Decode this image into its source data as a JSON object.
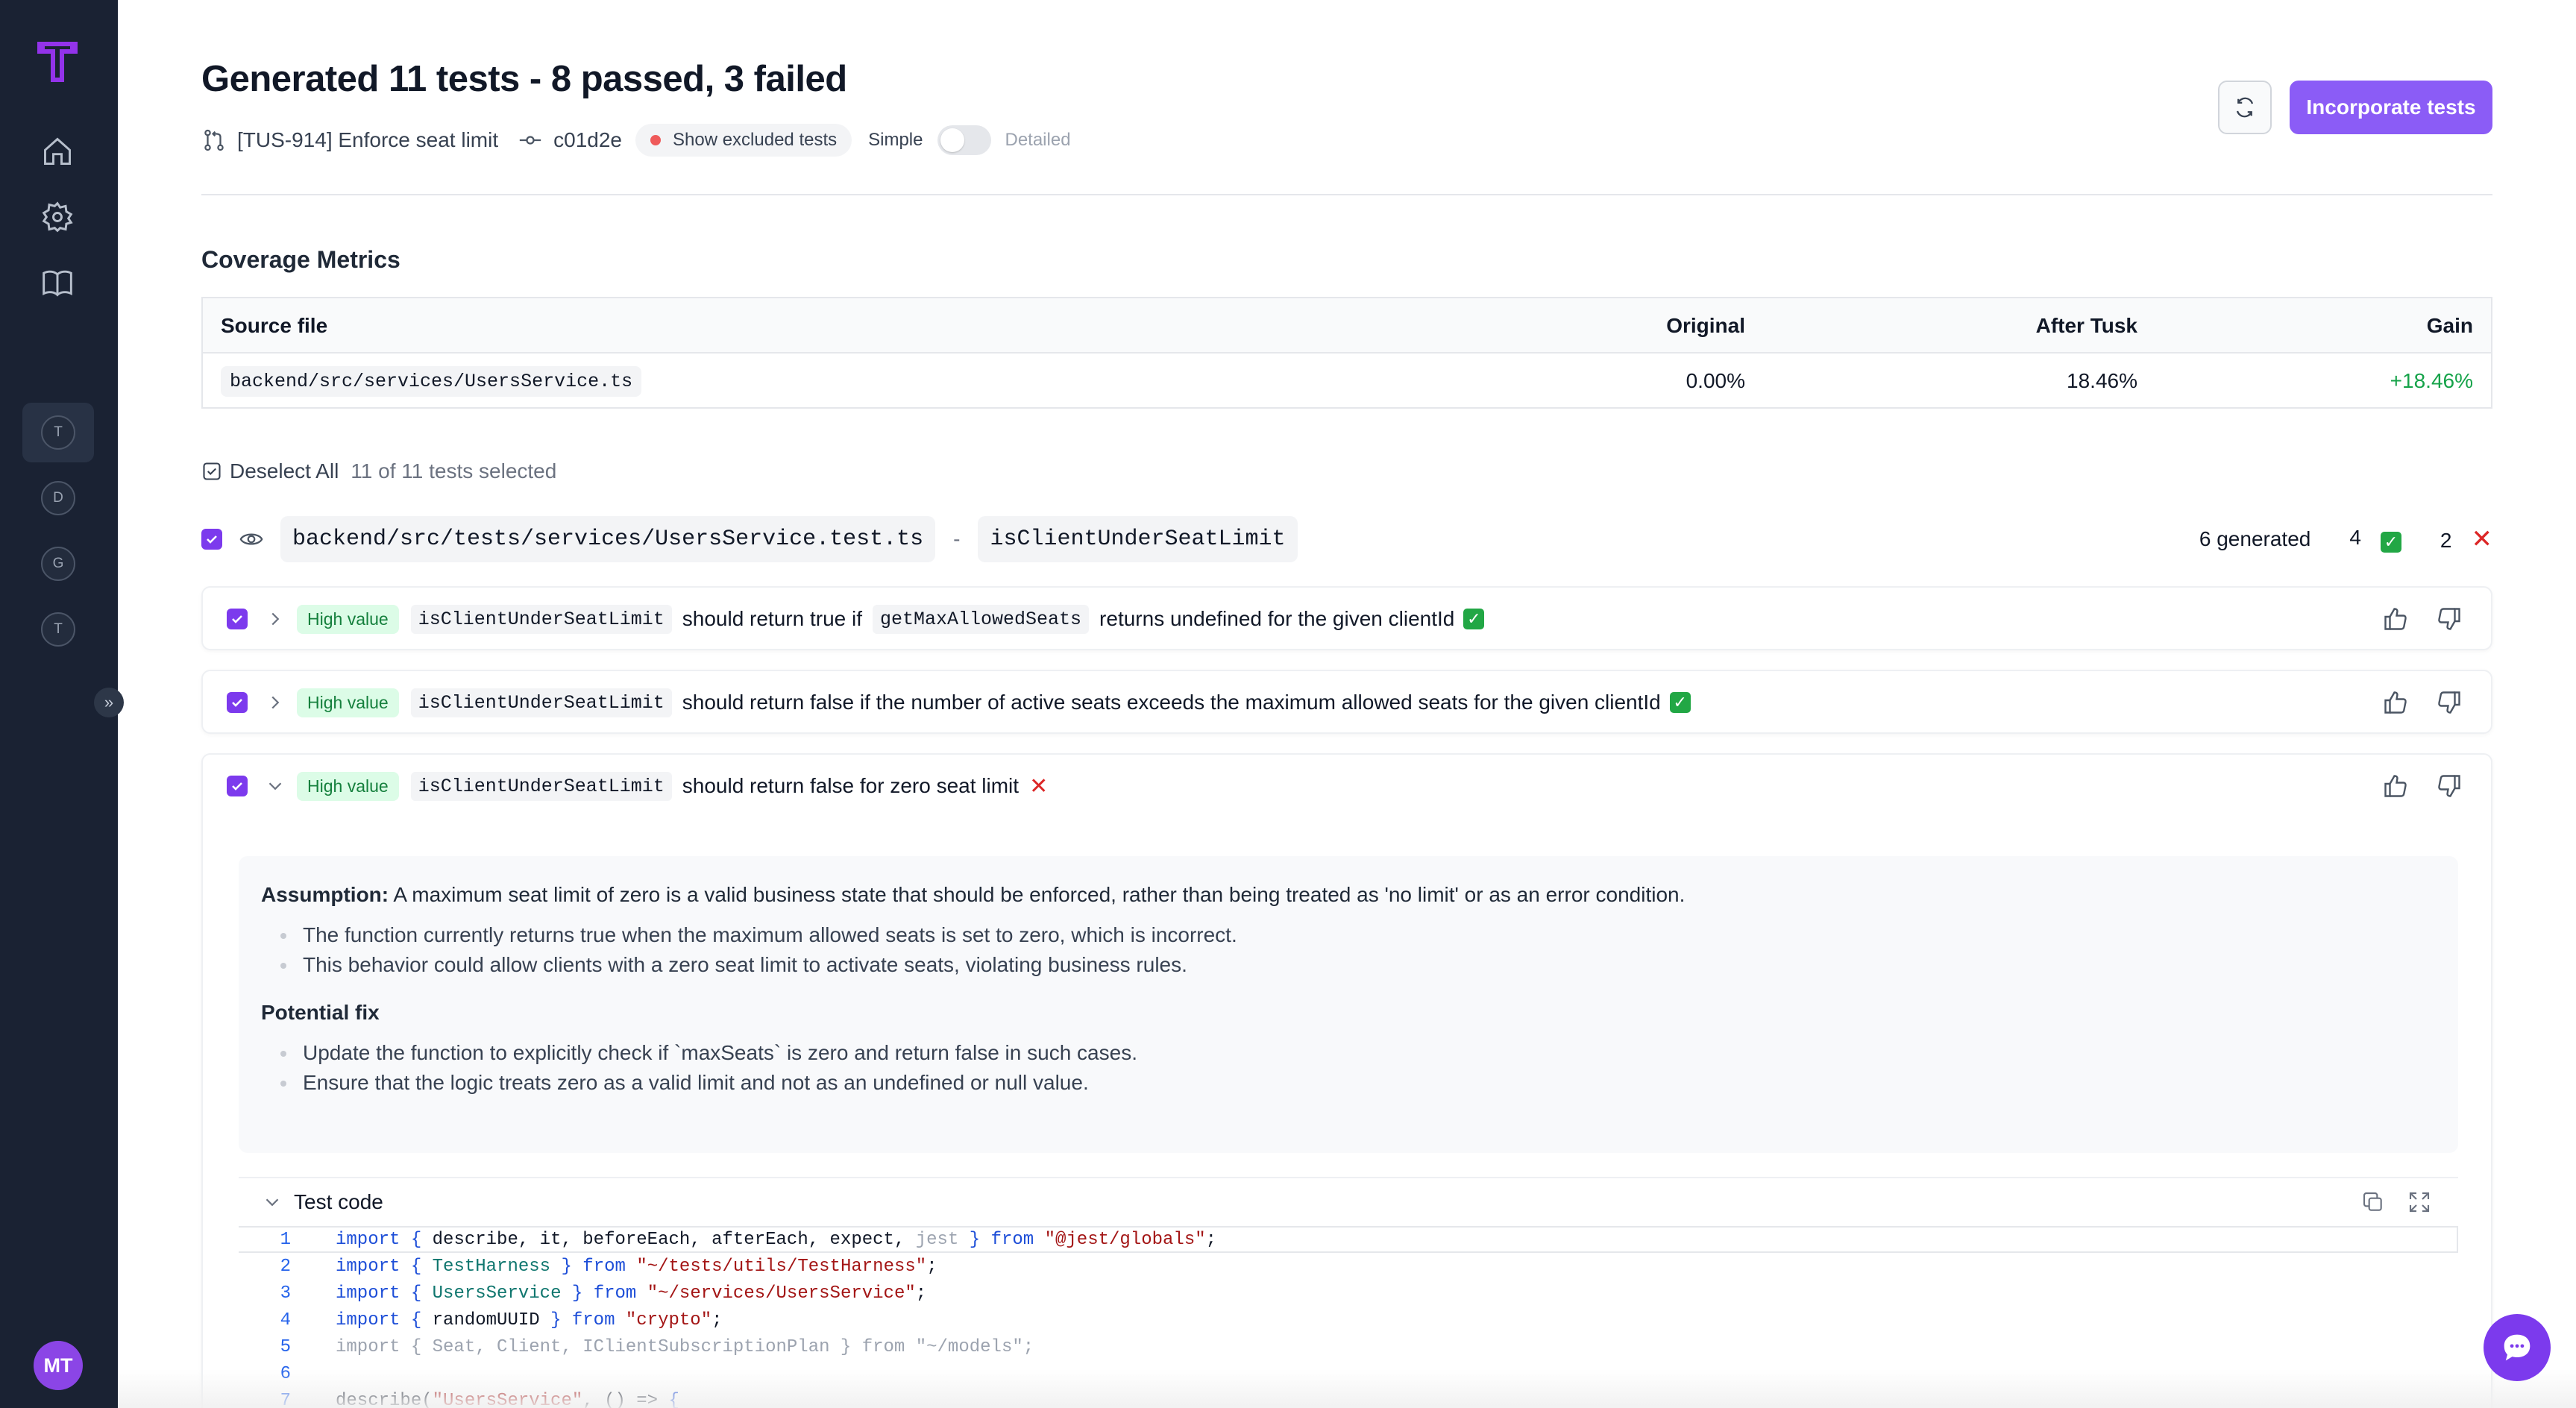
{
  "sidebar": {
    "workspaces": [
      {
        "initial": "T",
        "active": true
      },
      {
        "initial": "D",
        "active": false
      },
      {
        "initial": "G",
        "active": false
      },
      {
        "initial": "T",
        "active": false
      }
    ],
    "user_initials": "MT"
  },
  "header": {
    "title": "Generated 11 tests - 8 passed, 3 failed",
    "branch": "[TUS-914] Enforce seat limit",
    "commit": "c01d2e",
    "show_excluded_label": "Show excluded tests",
    "mode_simple": "Simple",
    "mode_detailed": "Detailed",
    "incorporate_label": "Incorporate tests"
  },
  "coverage": {
    "title": "Coverage Metrics",
    "headers": {
      "source": "Source file",
      "original": "Original",
      "after": "After Tusk",
      "gain": "Gain"
    },
    "row": {
      "source": "backend/src/services/UsersService.ts",
      "original": "0.00%",
      "after": "18.46%",
      "gain": "+18.46%"
    }
  },
  "selection": {
    "deselect_label": "Deselect All",
    "count_label": "11 of 11 tests selected"
  },
  "file_group": {
    "test_file": "backend/src/tests/services/UsersService.test.ts",
    "separator": "-",
    "function": "isClientUnderSeatLimit",
    "generated_label": "6 generated",
    "passed": "4",
    "failed": "2"
  },
  "tests": [
    {
      "badge": "High value",
      "fn": "isClientUnderSeatLimit",
      "desc_pre": "should return true if",
      "inline_code": "getMaxAllowedSeats",
      "desc_post": "returns undefined for the given clientId",
      "status": "passed"
    },
    {
      "badge": "High value",
      "fn": "isClientUnderSeatLimit",
      "desc": "should return false if the number of active seats exceeds the maximum allowed seats for the given clientId",
      "status": "passed"
    },
    {
      "badge": "High value",
      "fn": "isClientUnderSeatLimit",
      "desc": "should return false for zero seat limit",
      "status": "failed"
    }
  ],
  "details": {
    "assumption_label": "Assumption:",
    "assumption_text": "A maximum seat limit of zero is a valid business state that should be enforced, rather than being treated as 'no limit' or as an error condition.",
    "assumption_bullets": [
      "The function currently returns true when the maximum allowed seats is set to zero, which is incorrect.",
      "This behavior could allow clients with a zero seat limit to activate seats, violating business rules."
    ],
    "fix_title": "Potential fix",
    "fix_bullets": [
      "Update the function to explicitly check if `maxSeats` is zero and return false in such cases.",
      "Ensure that the logic treats zero as a valid limit and not as an undefined or null value."
    ]
  },
  "code": {
    "title": "Test code",
    "line_numbers": [
      "1",
      "2",
      "3",
      "4",
      "5",
      "6",
      "7"
    ]
  },
  "colors": {
    "accent": "#8b5cf6",
    "sidebar_bg": "#1a2233",
    "success": "#16a34a",
    "danger": "#dc2626"
  }
}
